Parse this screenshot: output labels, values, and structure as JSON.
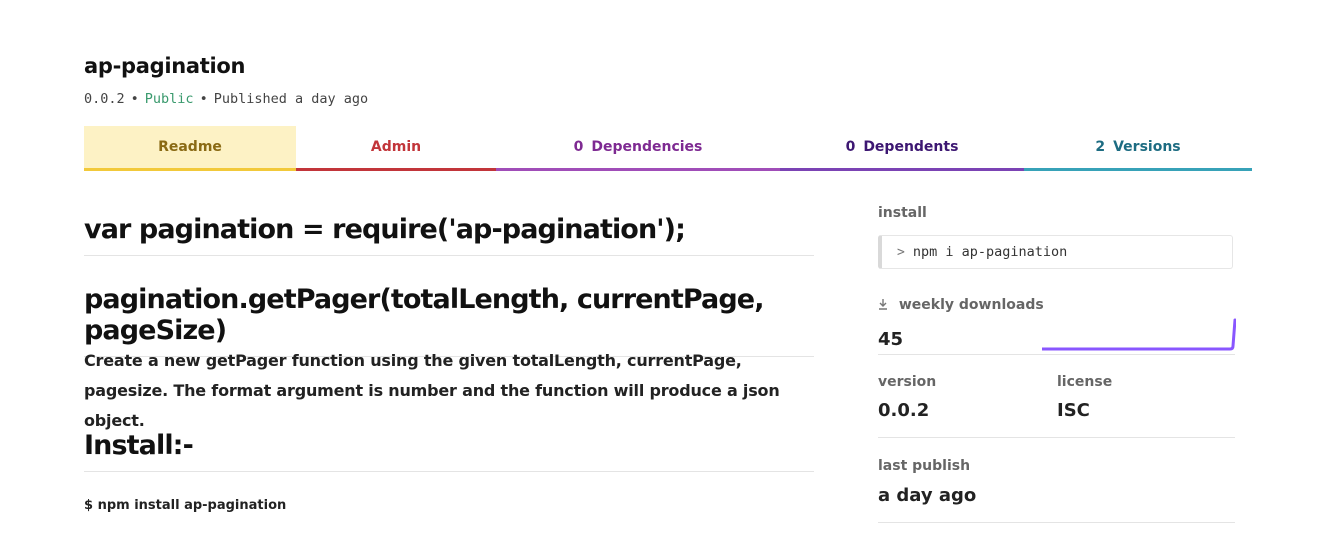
{
  "package": {
    "name": "ap-pagination",
    "version": "0.0.2",
    "visibility": "Public",
    "published": "Published a day ago",
    "separator": "•"
  },
  "tabs": [
    {
      "count": "",
      "label": "Readme"
    },
    {
      "count": "",
      "label": "Admin"
    },
    {
      "count": "0",
      "label": "Dependencies"
    },
    {
      "count": "0",
      "label": "Dependents"
    },
    {
      "count": "2",
      "label": "Versions"
    }
  ],
  "readme": {
    "heading_require": "var pagination = require('ap-pagination');",
    "heading_getpager": "pagination.getPager(totalLength, currentPage, pageSize)",
    "description": "Create a new getPager function using the given totalLength, currentPage, pagesize. The format argument is number and the function will produce a json object.",
    "heading_install": "Install:-",
    "install_command": "$ npm install ap-pagination"
  },
  "sidebar": {
    "install_label": "install",
    "install_prompt": ">",
    "install_command": "npm i ap-pagination",
    "downloads_label": "weekly downloads",
    "downloads_icon": "download-arrow-icon",
    "downloads_value": "45",
    "version_label": "version",
    "version_value": "0.0.2",
    "license_label": "license",
    "license_value": "ISC",
    "last_publish_label": "last publish",
    "last_publish_value": "a day ago",
    "sparkline_color": "#8956ff"
  }
}
